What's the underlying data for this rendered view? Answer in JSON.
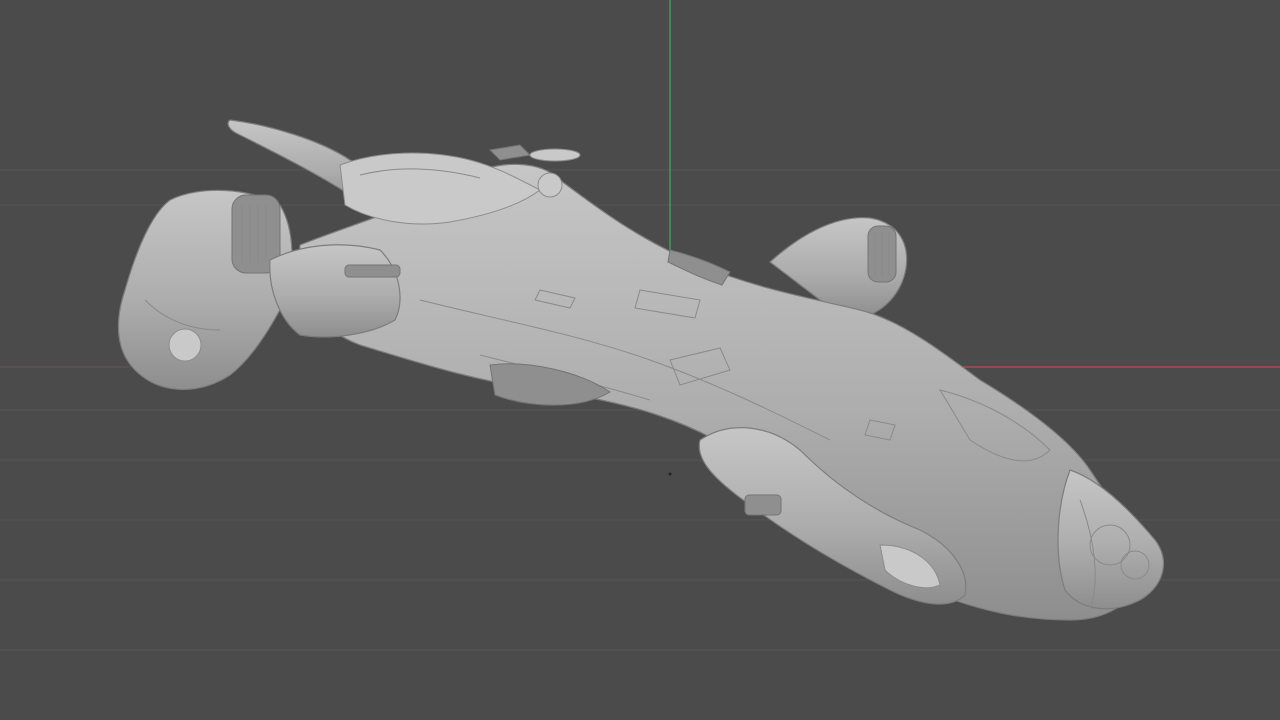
{
  "viewport": {
    "background": "#4b4b4b",
    "grid_color": "#545454",
    "axes": {
      "y_axis_color": "#3fbf6a",
      "x_axis_color": "#d94a5a"
    },
    "model": {
      "shading": "clay",
      "base_color": "#b5b5b5"
    }
  }
}
